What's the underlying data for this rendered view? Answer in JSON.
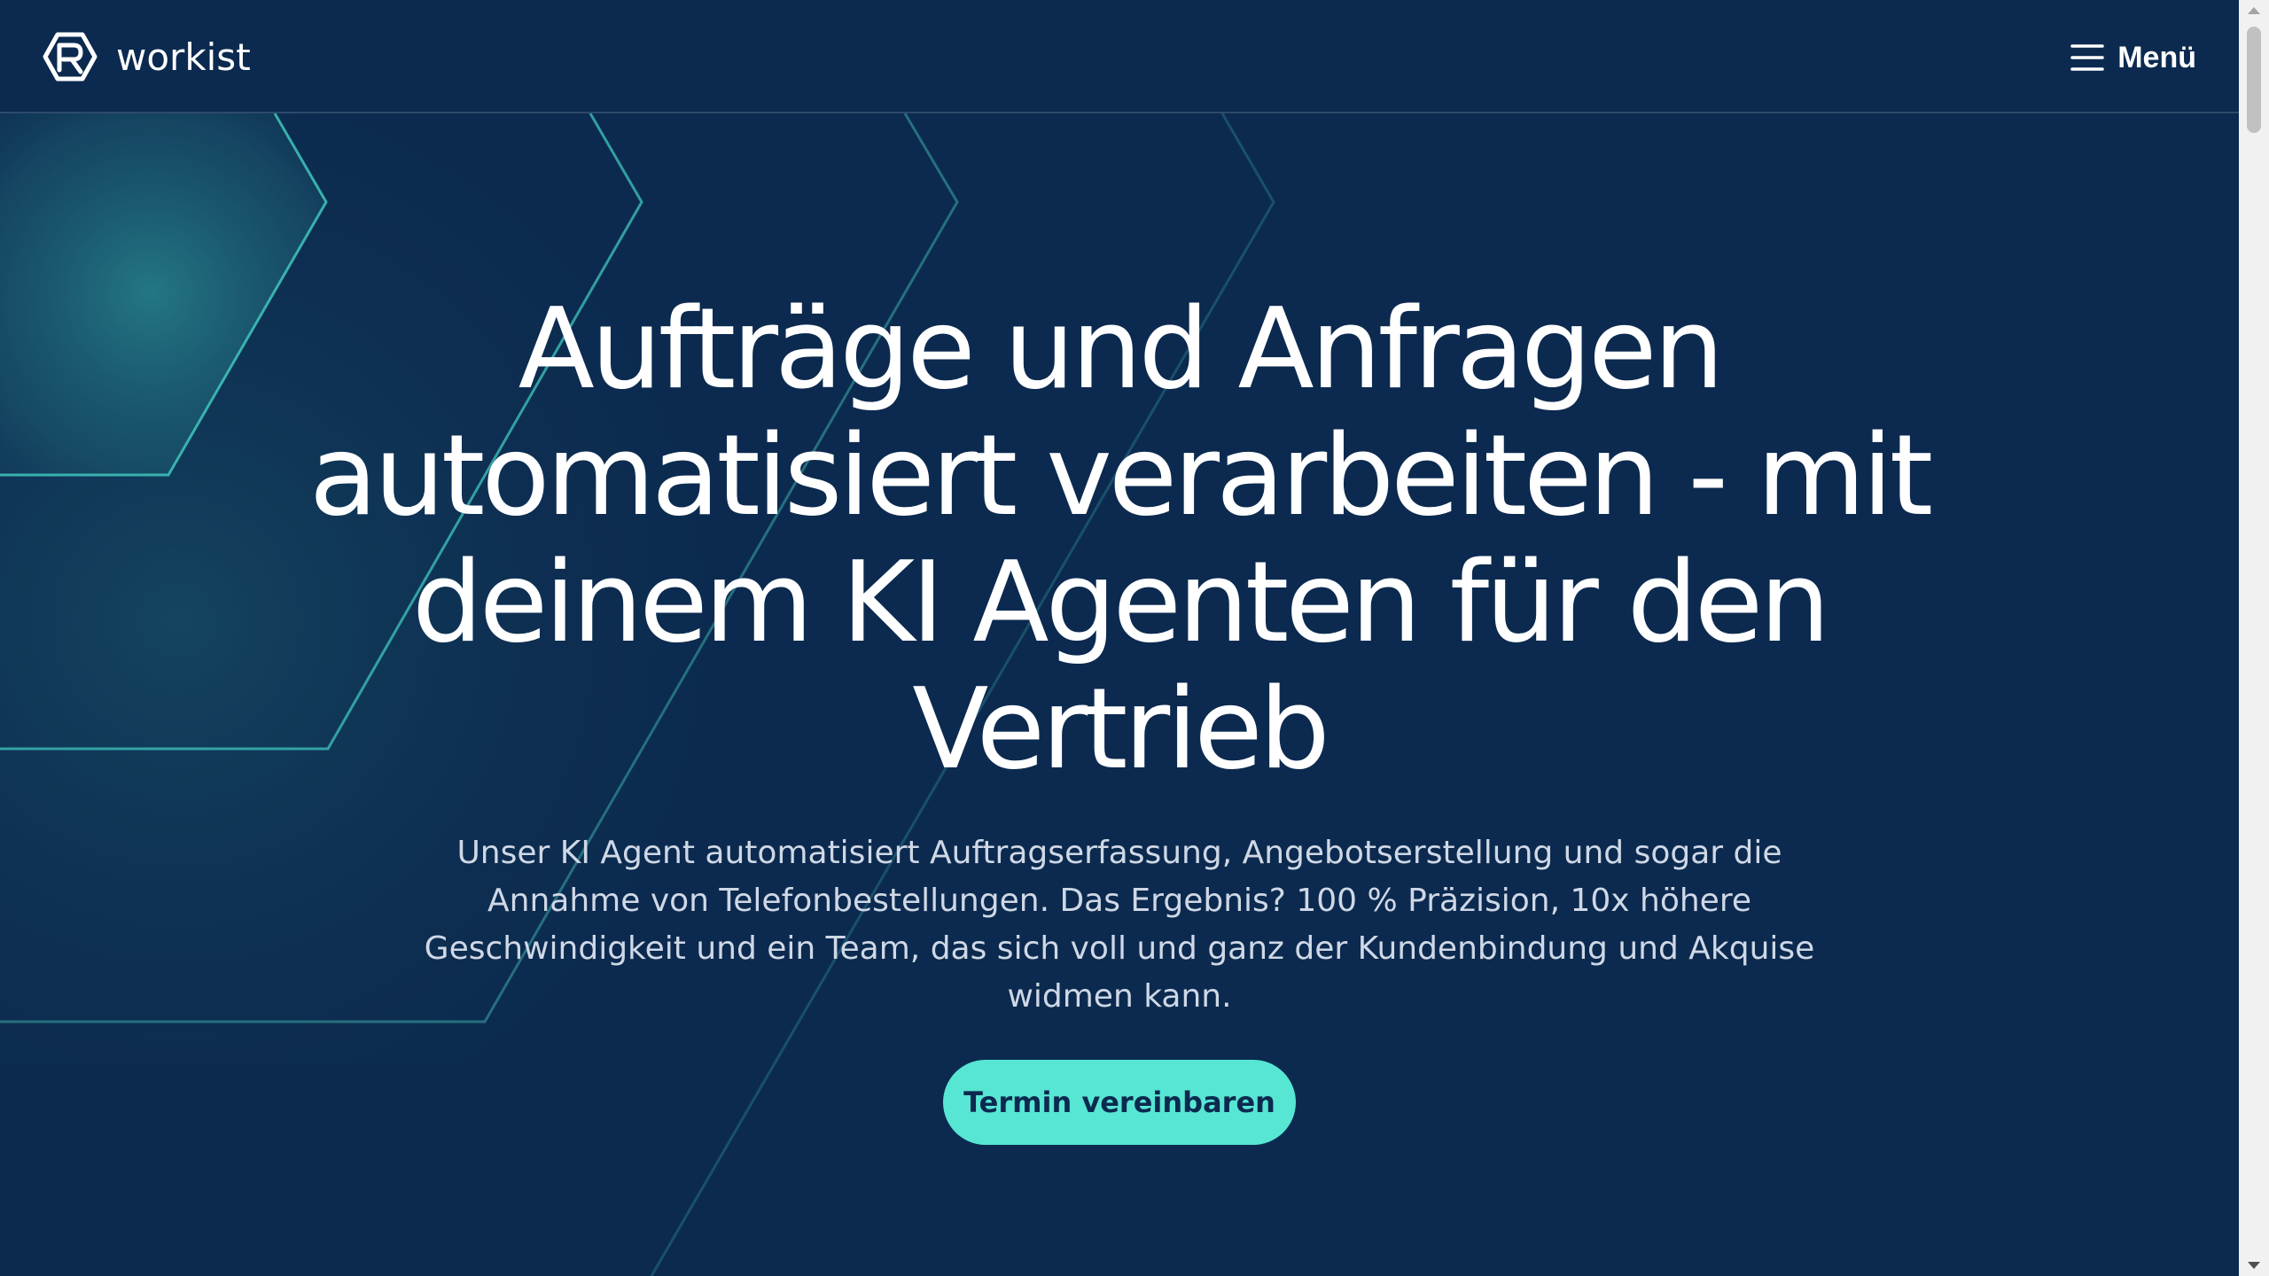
{
  "brand": {
    "name": "workist",
    "logo_icon": "workist-logo-icon"
  },
  "header": {
    "menu_label": "Menü",
    "menu_icon": "hamburger-menu-icon"
  },
  "hero": {
    "headline": "Aufträge und Anfragen automatisiert verarbeiten - mit deinem KI Agenten für den Vertrieb",
    "subheadline": "Unser KI Agent automatisiert Auftragserfassung, Angebotserstellung und sogar die Annahme von Telefonbestellungen. Das Ergebnis? 100 % Präzision, 10x höhere Geschwindigkeit und ein Team, das sich voll und ganz der Kundenbindung und Akquise widmen kann.",
    "cta_label": "Termin vereinbaren"
  },
  "colors": {
    "background": "#0c2a4f",
    "accent": "#57e6d3",
    "text": "#ffffff",
    "subtext": "#cfd8e6"
  }
}
